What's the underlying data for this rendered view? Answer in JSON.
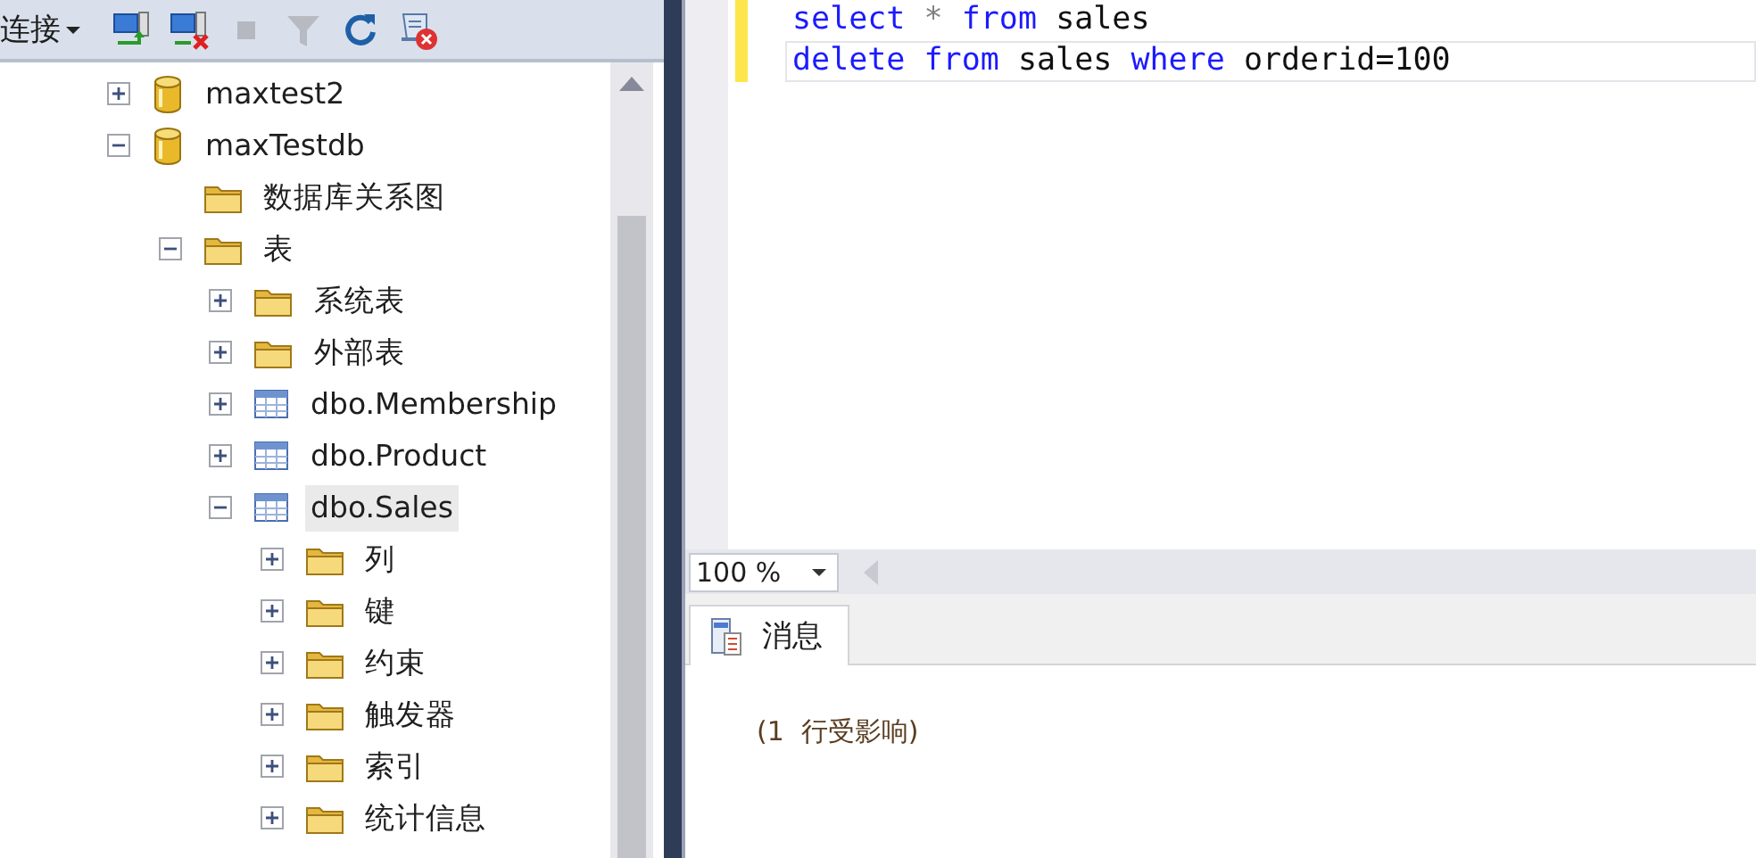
{
  "toolbar": {
    "connect_label": "连接",
    "buttons": [
      {
        "kind": "connect",
        "disabled": false
      },
      {
        "kind": "disconnect",
        "disabled": false
      },
      {
        "kind": "stop",
        "disabled": true
      },
      {
        "kind": "filter",
        "disabled": true
      },
      {
        "kind": "refresh",
        "disabled": false
      },
      {
        "kind": "script",
        "disabled": false
      }
    ]
  },
  "tree": [
    {
      "label": "maxtest2",
      "kind": "database",
      "expanded": false,
      "selected": false
    },
    {
      "label": "maxTestdb",
      "kind": "database",
      "expanded": true,
      "selected": false,
      "children": [
        {
          "label": "数据库关系图",
          "kind": "folder",
          "selected": false
        },
        {
          "label": "表",
          "kind": "folder",
          "expanded": true,
          "selected": false,
          "children": [
            {
              "label": "系统表",
              "kind": "folder",
              "expanded": false,
              "selected": false
            },
            {
              "label": "外部表",
              "kind": "folder",
              "expanded": false,
              "selected": false
            },
            {
              "label": "dbo.Membership",
              "kind": "table",
              "expanded": false,
              "selected": false
            },
            {
              "label": "dbo.Product",
              "kind": "table",
              "expanded": false,
              "selected": false
            },
            {
              "label": "dbo.Sales",
              "kind": "table",
              "expanded": true,
              "selected": true,
              "children": [
                {
                  "label": "列",
                  "kind": "folder",
                  "expanded": false,
                  "selected": false
                },
                {
                  "label": "键",
                  "kind": "folder",
                  "expanded": false,
                  "selected": false
                },
                {
                  "label": "约束",
                  "kind": "folder",
                  "expanded": false,
                  "selected": false
                },
                {
                  "label": "触发器",
                  "kind": "folder",
                  "expanded": false,
                  "selected": false
                },
                {
                  "label": "索引",
                  "kind": "folder",
                  "expanded": false,
                  "selected": false
                },
                {
                  "label": "统计信息",
                  "kind": "folder",
                  "expanded": false,
                  "selected": false
                }
              ]
            }
          ]
        }
      ]
    }
  ],
  "editor": {
    "lines": [
      {
        "current": false,
        "changed": true,
        "tokens": [
          {
            "kind": "keyword",
            "text": "select"
          },
          {
            "kind": "operator",
            "text": "*"
          },
          {
            "kind": "keyword",
            "text": "from"
          },
          {
            "kind": "plain",
            "text": "sales"
          }
        ]
      },
      {
        "current": true,
        "changed": true,
        "tokens": [
          {
            "kind": "keyword",
            "text": "delete"
          },
          {
            "kind": "keyword",
            "text": "from"
          },
          {
            "kind": "plain",
            "text": "sales"
          },
          {
            "kind": "keyword",
            "text": "where"
          },
          {
            "kind": "plain",
            "text": "orderid=100"
          }
        ]
      }
    ],
    "zoom": "100 %"
  },
  "results": {
    "tabs": [
      {
        "label": "消息",
        "selected": true
      }
    ],
    "message": "(1  行受影响)"
  }
}
